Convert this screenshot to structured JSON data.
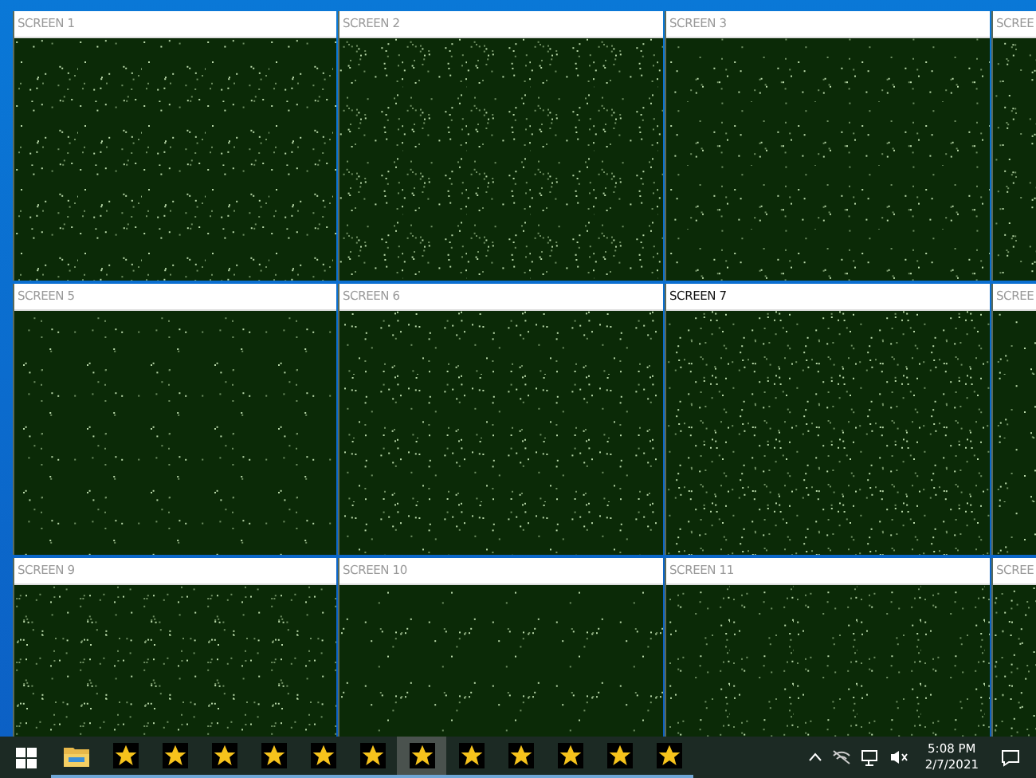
{
  "screens": [
    {
      "title": "SCREEN 1",
      "selected": false
    },
    {
      "title": "SCREEN 2",
      "selected": false
    },
    {
      "title": "SCREEN 3",
      "selected": false
    },
    {
      "title": "SCREE",
      "selected": false
    },
    {
      "title": "SCREEN 5",
      "selected": false
    },
    {
      "title": "SCREEN 6",
      "selected": false
    },
    {
      "title": "SCREEN 7",
      "selected": true
    },
    {
      "title": "SCREE",
      "selected": false
    },
    {
      "title": "SCREEN 9",
      "selected": false
    },
    {
      "title": "SCREEN 10",
      "selected": false
    },
    {
      "title": "SCREEN 11",
      "selected": false
    },
    {
      "title": "SCREE",
      "selected": false
    }
  ],
  "taskbar": {
    "apps": [
      {
        "kind": "folder",
        "selected": false
      },
      {
        "kind": "star",
        "selected": false
      },
      {
        "kind": "star",
        "selected": false
      },
      {
        "kind": "star",
        "selected": false
      },
      {
        "kind": "star",
        "selected": false
      },
      {
        "kind": "star",
        "selected": false
      },
      {
        "kind": "star",
        "selected": false
      },
      {
        "kind": "star",
        "selected": true
      },
      {
        "kind": "star",
        "selected": false
      },
      {
        "kind": "star",
        "selected": false
      },
      {
        "kind": "star",
        "selected": false
      },
      {
        "kind": "star",
        "selected": false
      },
      {
        "kind": "star",
        "selected": false
      }
    ],
    "time": "5:08 PM",
    "date": "2/7/2021"
  }
}
